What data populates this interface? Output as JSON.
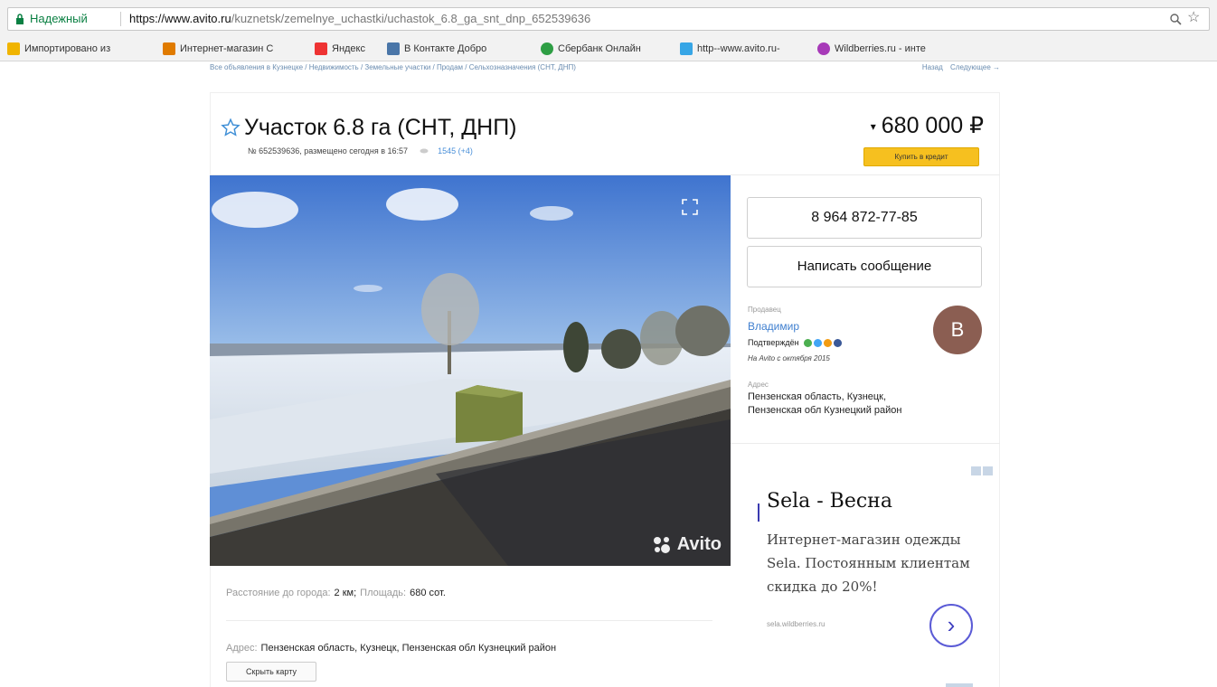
{
  "browser": {
    "secure_label": "Надежный",
    "url_scheme_host": "https://www.avito.ru",
    "url_path": "/kuznetsk/zemelnye_uchastki/uchastok_6.8_ga_snt_dnp_652539636"
  },
  "bookmarks": [
    {
      "label": "Импортировано из",
      "color": "#f0b400"
    },
    {
      "label": "Интернет-магазин C",
      "color": "#e07b00"
    },
    {
      "label": "Яндекс",
      "color": "#e33"
    },
    {
      "label": "В Контакте  Добро",
      "color": "#4a76a8"
    },
    {
      "label": "Сбербанк Онлайн",
      "color": "#2e9e44"
    },
    {
      "label": "http--www.avito.ru-",
      "color": "#37a6e6"
    },
    {
      "label": "Wildberries.ru - инте",
      "color": "#a73ab8"
    }
  ],
  "breadcrumbs": "Все объявления в Кузнецке / Недвижимость / Земельные участки / Продам / Сельхозназначения (СНТ, ДНП)",
  "nav": {
    "back": "Назад",
    "next": "Следующее →"
  },
  "listing": {
    "title": "Участок 6.8 га (СНТ, ДНП)",
    "meta": "№ 652539636, размещено сегодня в 16:57",
    "views": "1545 (+4)",
    "price": "680 000 ₽",
    "credit_button": "Купить в кредит"
  },
  "contact": {
    "phone": "8 964 872-77-85",
    "message_button": "Написать сообщение",
    "seller_label": "Продавец",
    "seller_name": "Владимир",
    "verified": "Подтверждён",
    "since": "На Avito с октября 2015",
    "avatar_letter": "В",
    "address_label": "Адрес",
    "address_line1": "Пензенская область, Кузнецк,",
    "address_line2": "Пензенская обл Кузнецкий район"
  },
  "ad": {
    "title": "Sela - Весна",
    "text": "Интернет-магазин одежды Sela. Постоянным клиентам скидка до 20%!",
    "url": "sela.wildberries.ru",
    "arrow": "›"
  },
  "photo": {
    "watermark": "Avito"
  },
  "params": {
    "distance_label": "Расстояние до города:",
    "distance_value": "2 км;",
    "area_label": "Площадь:",
    "area_value": "680 сот."
  },
  "address_block": {
    "label": "Адрес:",
    "value": "Пензенская область, Кузнецк, Пензенская обл Кузнецкий район",
    "hide_map_button": "Скрыть карту"
  },
  "colors": {
    "accent_link": "#3f7fcf",
    "credit_yellow": "#f6c01f",
    "secure_green": "#0b8043"
  }
}
